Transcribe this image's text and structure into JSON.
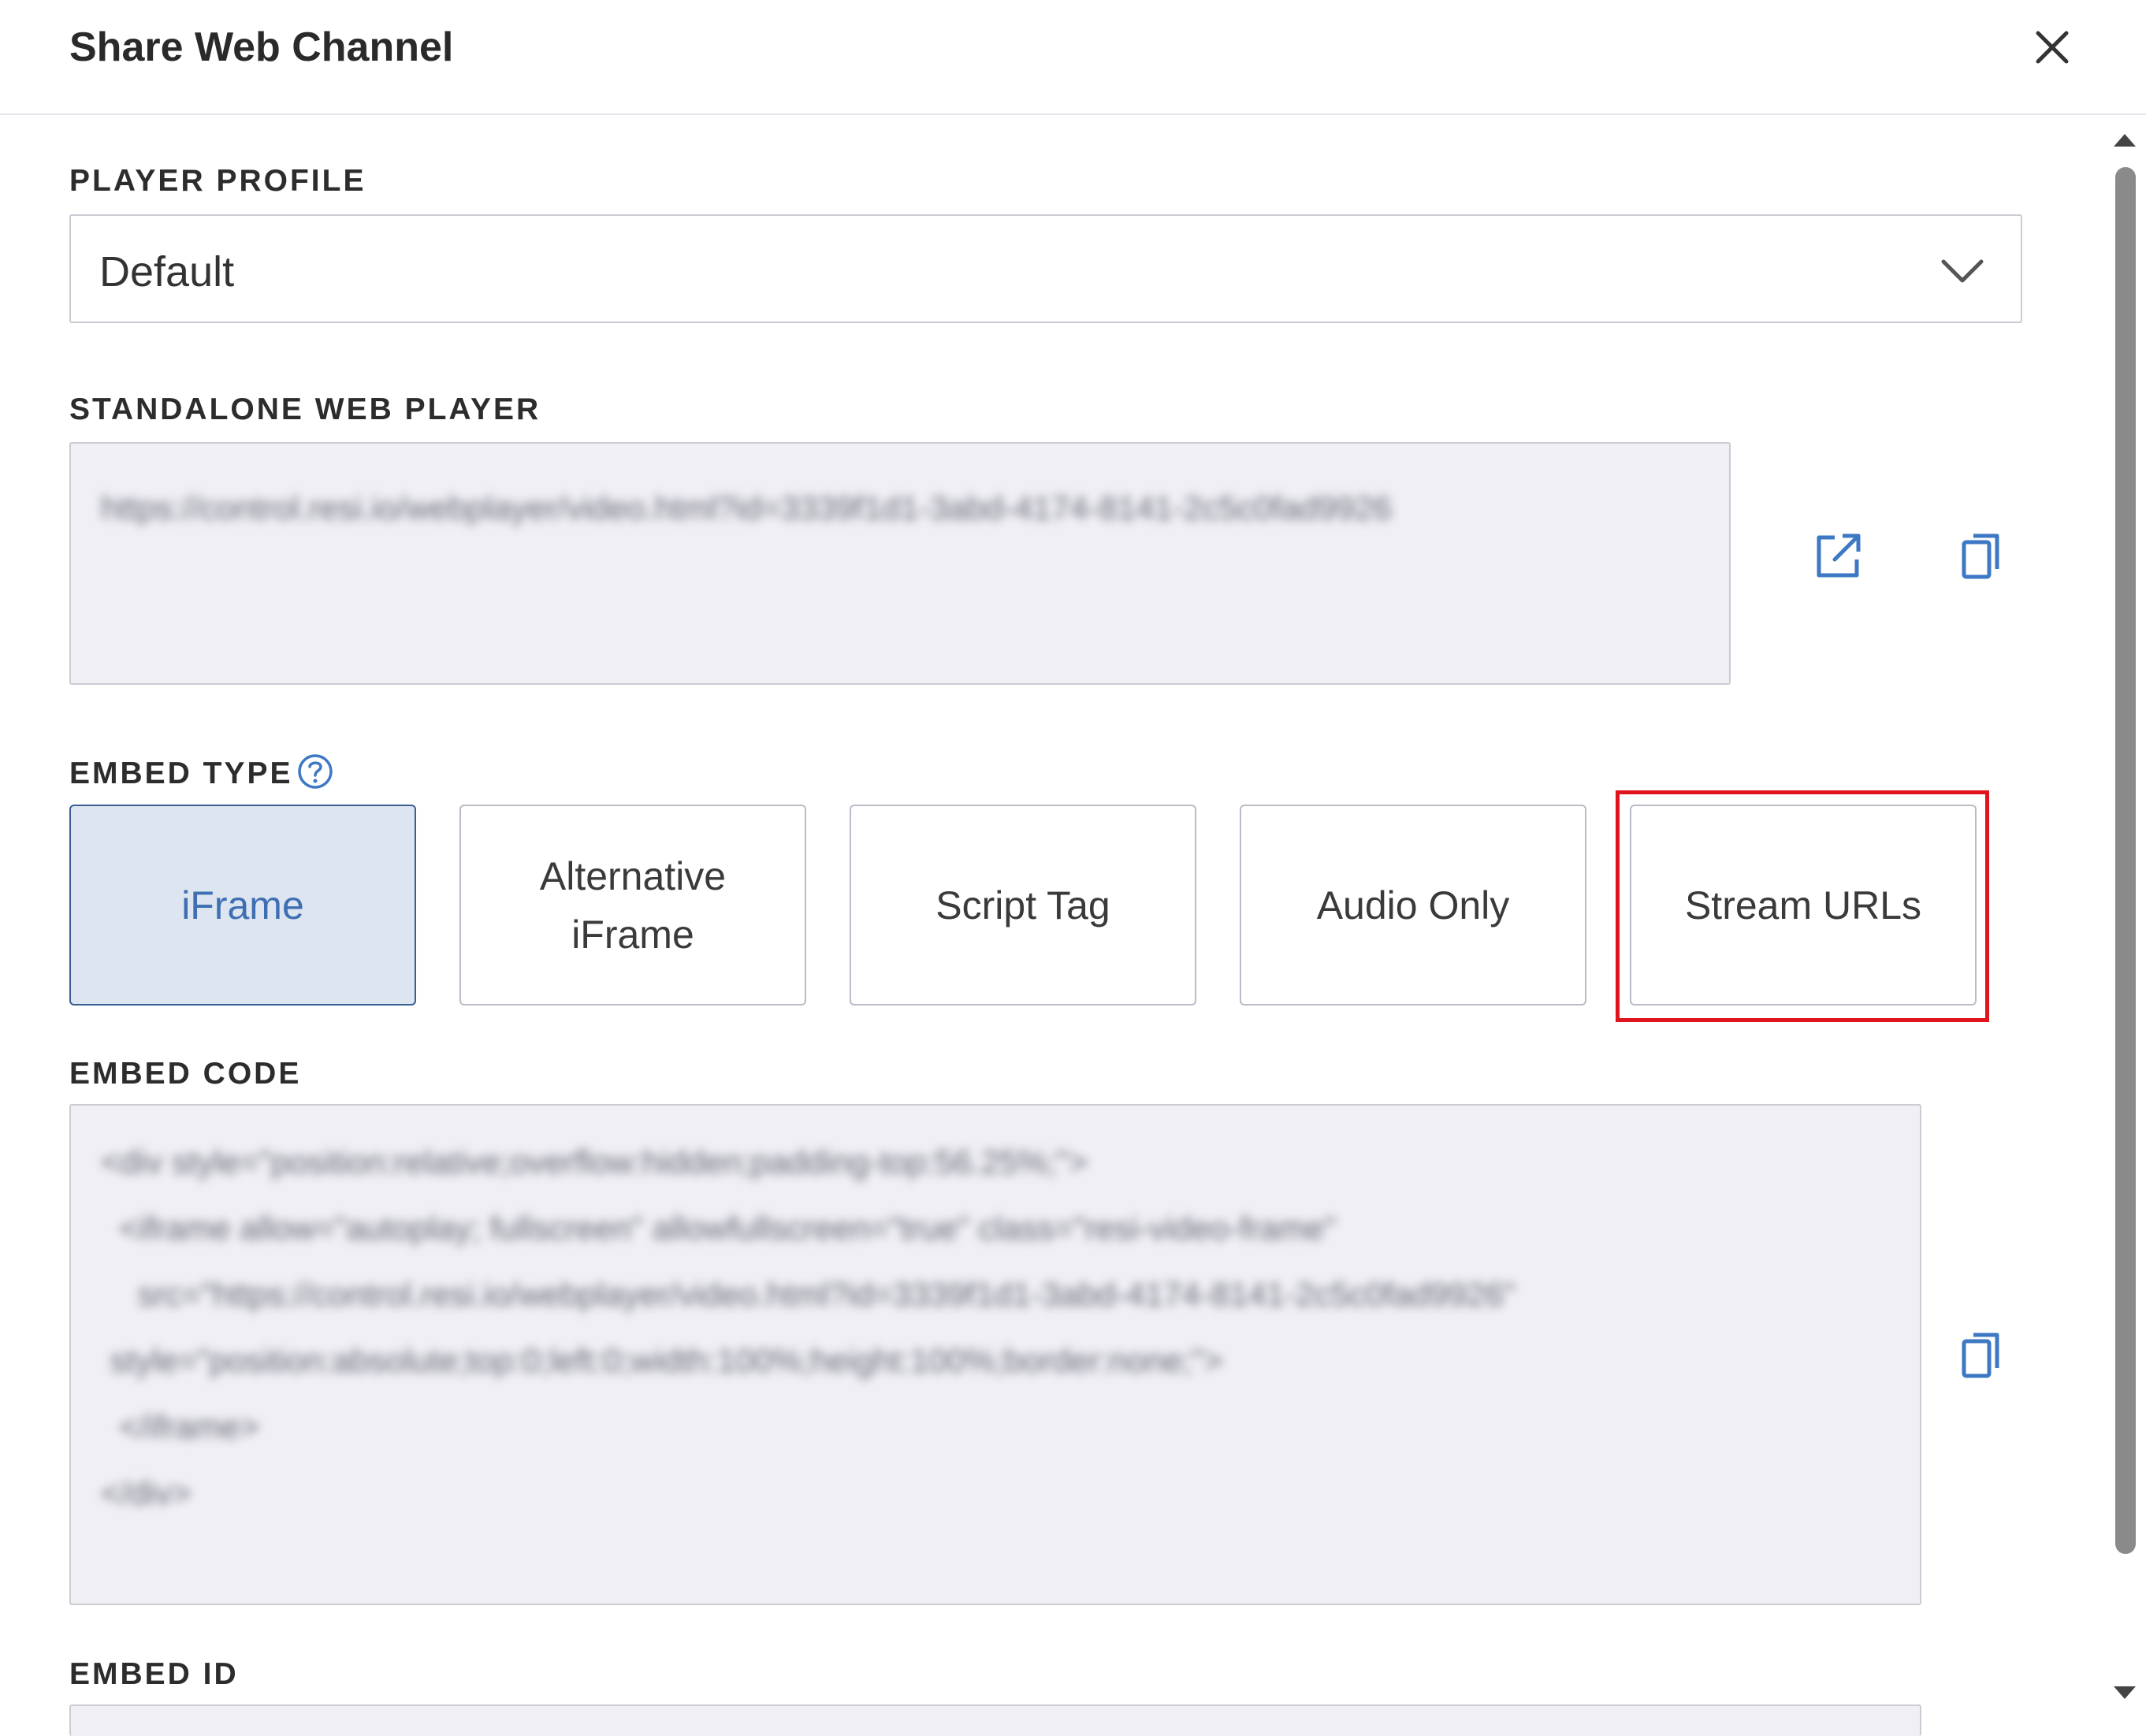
{
  "dialog": {
    "title": "Share Web Channel",
    "close_icon": "close-icon"
  },
  "player_profile": {
    "label": "PLAYER PROFILE",
    "selected": "Default"
  },
  "standalone": {
    "label": "STANDALONE WEB PLAYER",
    "url": "https://control.resi.io/webplayer/video.html?id=3339f1d1-3abd-4174-8141-2c5c0fad9926",
    "open_icon": "external-link-icon",
    "copy_icon": "copy-icon"
  },
  "embed_type": {
    "label": "EMBED TYPE",
    "help_icon": "question-circle-icon",
    "options": [
      {
        "label": "iFrame",
        "active": true
      },
      {
        "label": "Alternative iFrame",
        "active": false
      },
      {
        "label": "Script Tag",
        "active": false
      },
      {
        "label": "Audio Only",
        "active": false
      },
      {
        "label": "Stream URLs",
        "active": false
      }
    ]
  },
  "embed_code": {
    "label": "EMBED CODE",
    "code": "<div style=\"position:relative;overflow:hidden;padding-top:56.25%;\">\n  <iframe allow=\"autoplay; fullscreen\" allowfullscreen=\"true\" class=\"resi-video-frame\"\n    src=\"https://control.resi.io/webplayer/video.html?id=3339f1d1-3abd-4174-8141-2c5c0fad9926\"\n style=\"position:absolute;top:0;left:0;width:100%;height:100%;border:none;\">\n  </iframe>\n</div>",
    "copy_icon": "copy-icon"
  },
  "embed_id": {
    "label": "EMBED ID"
  },
  "colors": {
    "accent": "#3d6fb2",
    "active_bg": "#dde5f0",
    "highlight": "#e0141e",
    "field_bg": "#efeff4"
  }
}
